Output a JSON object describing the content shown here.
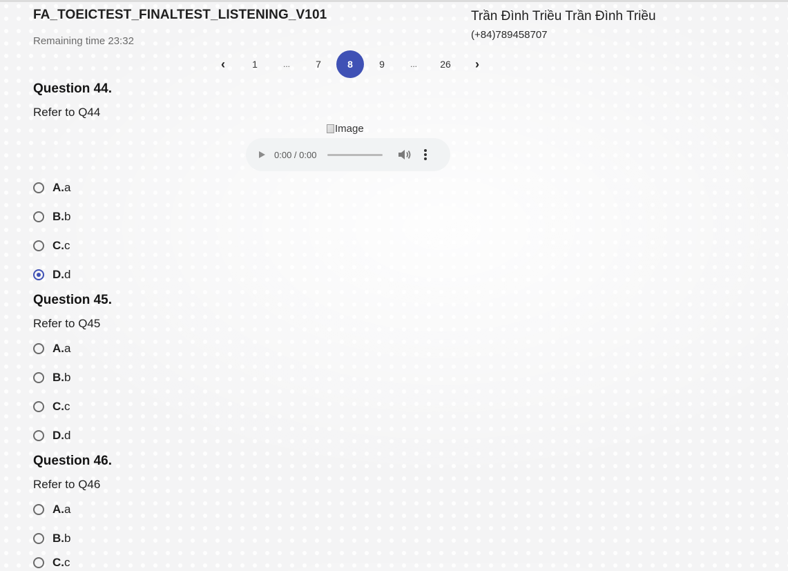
{
  "header": {
    "test_title": "FA_TOEICTEST_FINALTEST_LISTENING_V101",
    "remaining_time": "Remaining time 23:32",
    "user_name": "Trần Đình Triều Trần Đình Triều",
    "user_phone": "(+84)789458707"
  },
  "pagination": {
    "prev_icon": "chevron-left-icon",
    "next_icon": "chevron-right-icon",
    "pages": [
      "1",
      "...",
      "7",
      "8",
      "9",
      "...",
      "26"
    ],
    "current": "8"
  },
  "media": {
    "image_alt": "Image",
    "audio_time": "0:00 / 0:00"
  },
  "questions": [
    {
      "title": "Question 44.",
      "text": "Refer to Q44",
      "options": [
        {
          "letter": "A.",
          "text": "a",
          "checked": false
        },
        {
          "letter": "B.",
          "text": "b",
          "checked": false
        },
        {
          "letter": "C.",
          "text": "c",
          "checked": false
        },
        {
          "letter": "D.",
          "text": "d",
          "checked": true
        }
      ]
    },
    {
      "title": "Question 45.",
      "text": "Refer to Q45",
      "options": [
        {
          "letter": "A.",
          "text": "a",
          "checked": false
        },
        {
          "letter": "B.",
          "text": "b",
          "checked": false
        },
        {
          "letter": "C.",
          "text": "c",
          "checked": false
        },
        {
          "letter": "D.",
          "text": "d",
          "checked": false
        }
      ]
    },
    {
      "title": "Question 46.",
      "text": "Refer to Q46",
      "options": [
        {
          "letter": "A.",
          "text": "a",
          "checked": false
        },
        {
          "letter": "B.",
          "text": "b",
          "checked": false
        },
        {
          "letter": "C.",
          "text": "c",
          "checked": false
        }
      ]
    }
  ],
  "colors": {
    "accent": "#3f51b5",
    "background": "#f4f4f5"
  }
}
